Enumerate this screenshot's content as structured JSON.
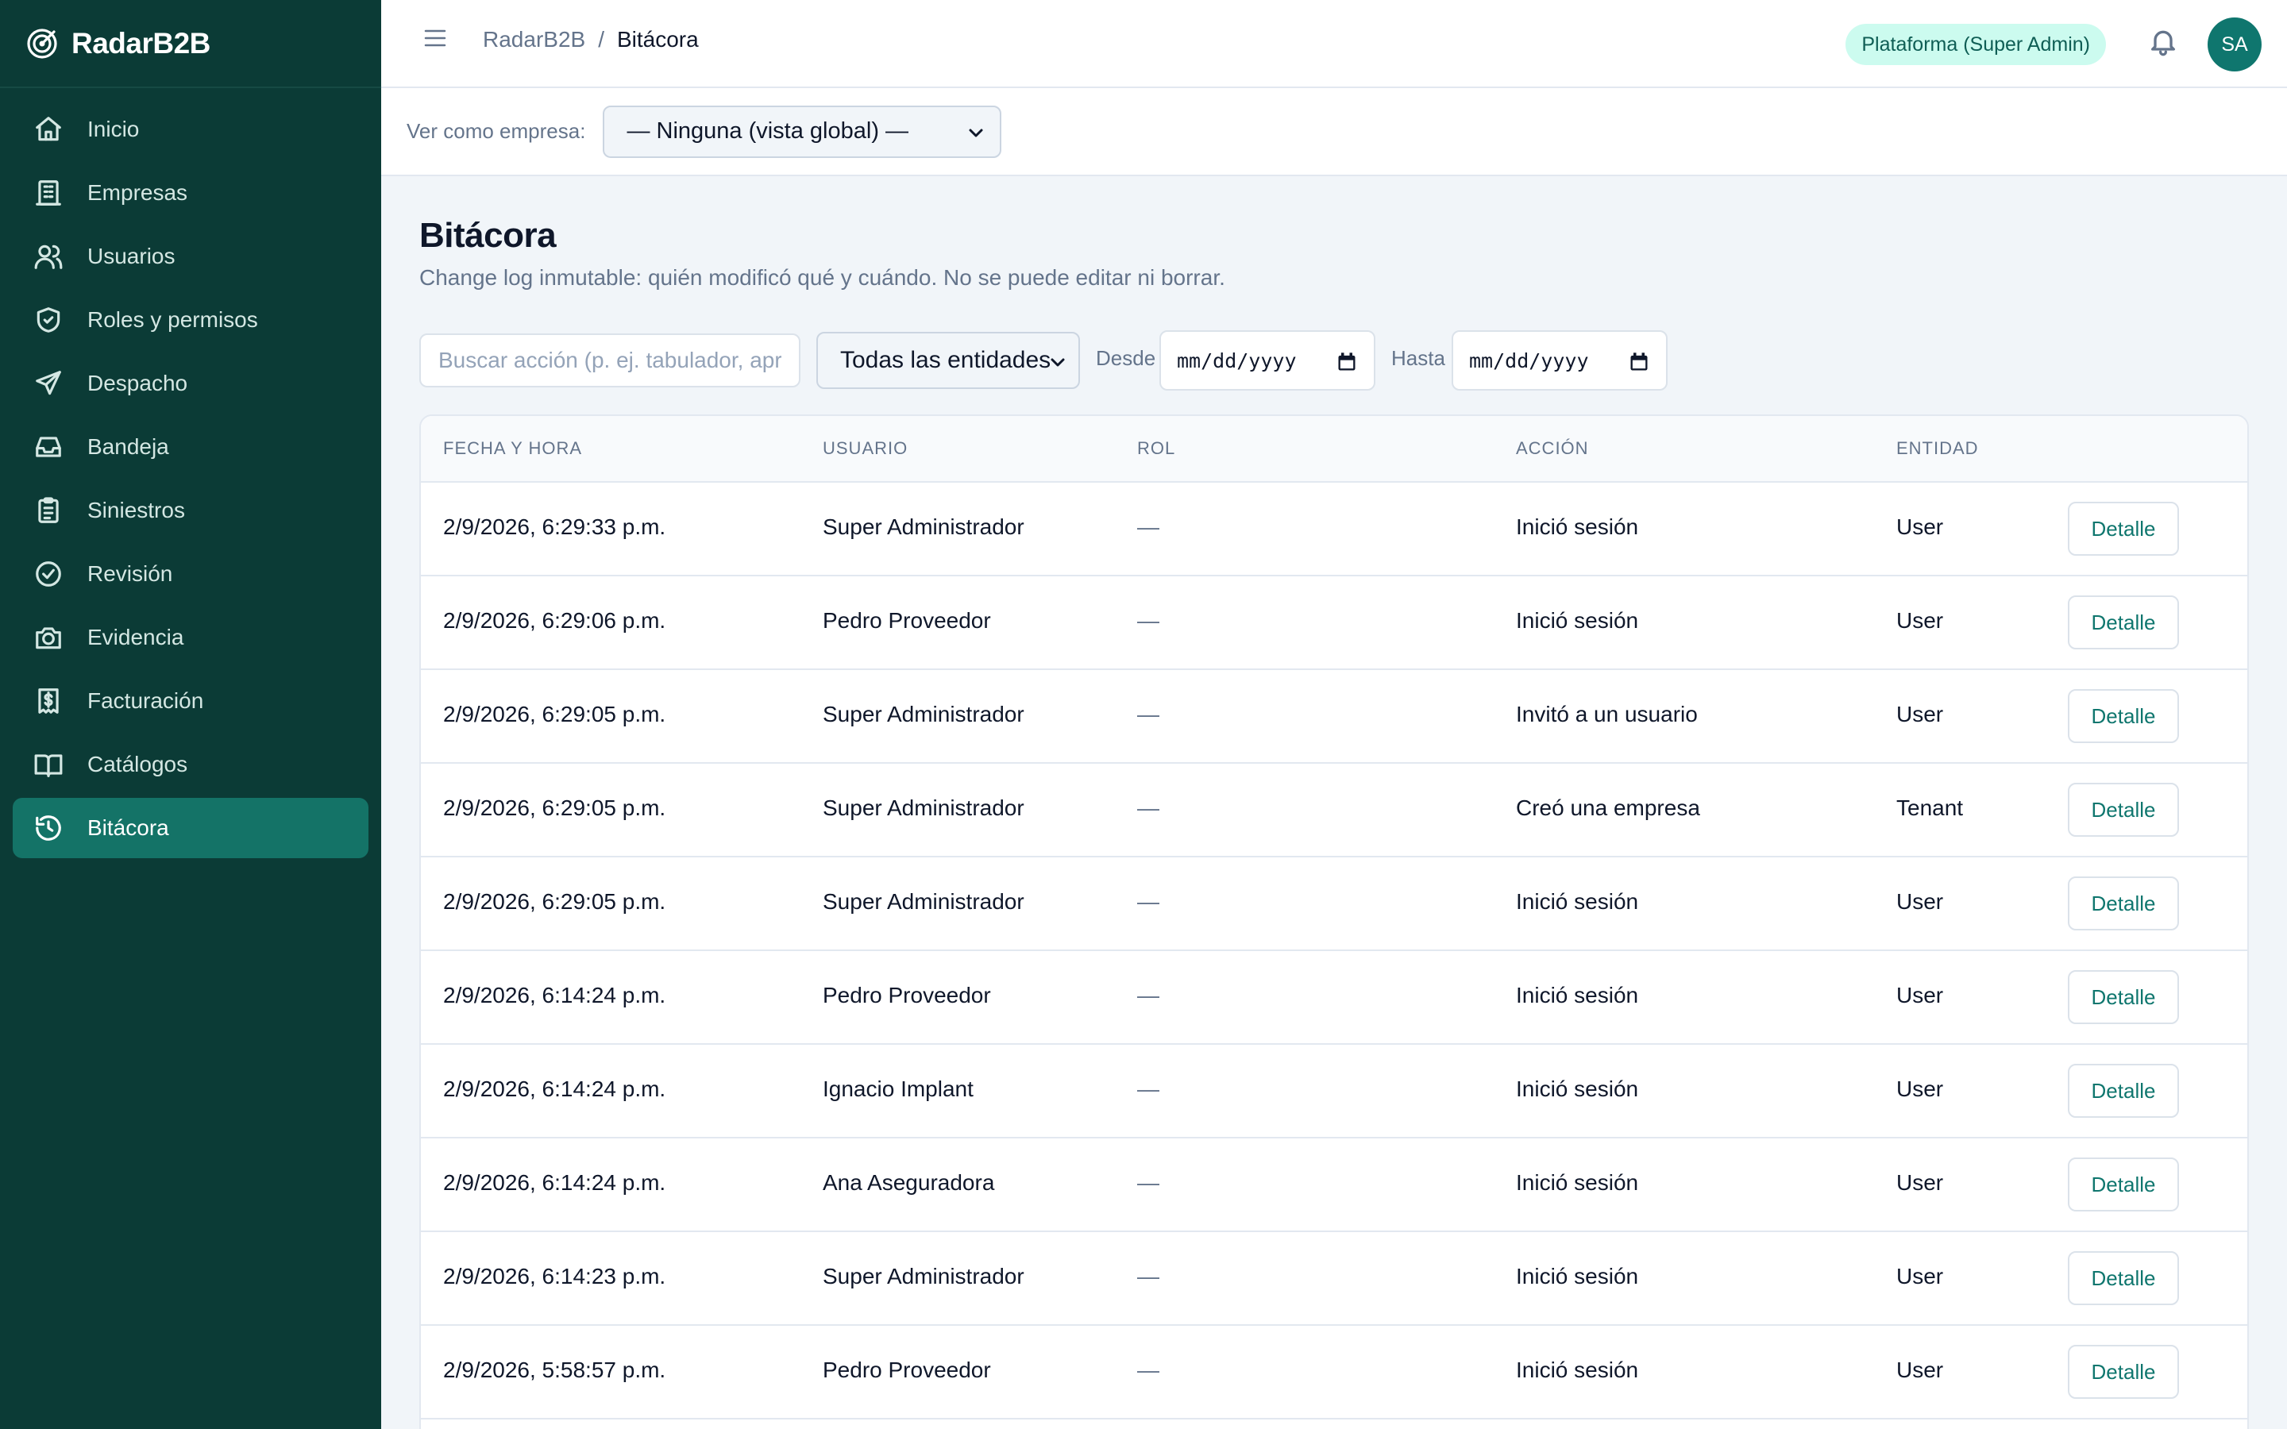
{
  "app": {
    "name": "RadarB2B"
  },
  "sidebar": {
    "items": [
      {
        "label": "Inicio",
        "icon": "home-icon"
      },
      {
        "label": "Empresas",
        "icon": "building-icon"
      },
      {
        "label": "Usuarios",
        "icon": "users-icon"
      },
      {
        "label": "Roles y permisos",
        "icon": "shield-check-icon"
      },
      {
        "label": "Despacho",
        "icon": "send-icon"
      },
      {
        "label": "Bandeja",
        "icon": "inbox-icon"
      },
      {
        "label": "Siniestros",
        "icon": "clipboard-icon"
      },
      {
        "label": "Revisión",
        "icon": "check-circle-icon"
      },
      {
        "label": "Evidencia",
        "icon": "camera-icon"
      },
      {
        "label": "Facturación",
        "icon": "receipt-icon"
      },
      {
        "label": "Catálogos",
        "icon": "book-open-icon"
      },
      {
        "label": "Bitácora",
        "icon": "history-icon",
        "active": true
      }
    ]
  },
  "header": {
    "breadcrumb_root": "RadarB2B",
    "breadcrumb_sep": "/",
    "breadcrumb_current": "Bitácora",
    "role_badge": "Plataforma (Super Admin)",
    "avatar_initials": "SA"
  },
  "company_bar": {
    "label": "Ver como empresa:",
    "selected": "— Ninguna (vista global) —"
  },
  "page": {
    "title": "Bitácora",
    "subtitle": "Change log inmutable: quién modificó qué y cuándo. No se puede editar ni borrar."
  },
  "filters": {
    "search_placeholder": "Buscar acción (p. ej. tabulador, aprobar)",
    "entity_selected": "Todas las entidades",
    "from_label": "Desde",
    "from_value": "mm/dd/yyyy",
    "to_label": "Hasta",
    "to_value": "mm/dd/yyyy"
  },
  "table": {
    "columns": [
      "FECHA Y HORA",
      "USUARIO",
      "ROL",
      "ACCIÓN",
      "ENTIDAD"
    ],
    "detail_label": "Detalle",
    "rows": [
      {
        "datetime": "2/9/2026, 6:29:33 p.m.",
        "user": "Super Administrador",
        "role": "—",
        "action": "Inició sesión",
        "entity": "User"
      },
      {
        "datetime": "2/9/2026, 6:29:06 p.m.",
        "user": "Pedro Proveedor",
        "role": "—",
        "action": "Inició sesión",
        "entity": "User"
      },
      {
        "datetime": "2/9/2026, 6:29:05 p.m.",
        "user": "Super Administrador",
        "role": "—",
        "action": "Invitó a un usuario",
        "entity": "User"
      },
      {
        "datetime": "2/9/2026, 6:29:05 p.m.",
        "user": "Super Administrador",
        "role": "—",
        "action": "Creó una empresa",
        "entity": "Tenant"
      },
      {
        "datetime": "2/9/2026, 6:29:05 p.m.",
        "user": "Super Administrador",
        "role": "—",
        "action": "Inició sesión",
        "entity": "User"
      },
      {
        "datetime": "2/9/2026, 6:14:24 p.m.",
        "user": "Pedro Proveedor",
        "role": "—",
        "action": "Inició sesión",
        "entity": "User"
      },
      {
        "datetime": "2/9/2026, 6:14:24 p.m.",
        "user": "Ignacio Implant",
        "role": "—",
        "action": "Inició sesión",
        "entity": "User"
      },
      {
        "datetime": "2/9/2026, 6:14:24 p.m.",
        "user": "Ana Aseguradora",
        "role": "—",
        "action": "Inició sesión",
        "entity": "User"
      },
      {
        "datetime": "2/9/2026, 6:14:23 p.m.",
        "user": "Super Administrador",
        "role": "—",
        "action": "Inició sesión",
        "entity": "User"
      },
      {
        "datetime": "2/9/2026, 5:58:57 p.m.",
        "user": "Pedro Proveedor",
        "role": "—",
        "action": "Inició sesión",
        "entity": "User"
      }
    ]
  },
  "colors": {
    "sidebar_bg": "#0b3b36",
    "sidebar_active": "#147367",
    "accent": "#0f766e",
    "badge_bg": "#ccfbef"
  }
}
